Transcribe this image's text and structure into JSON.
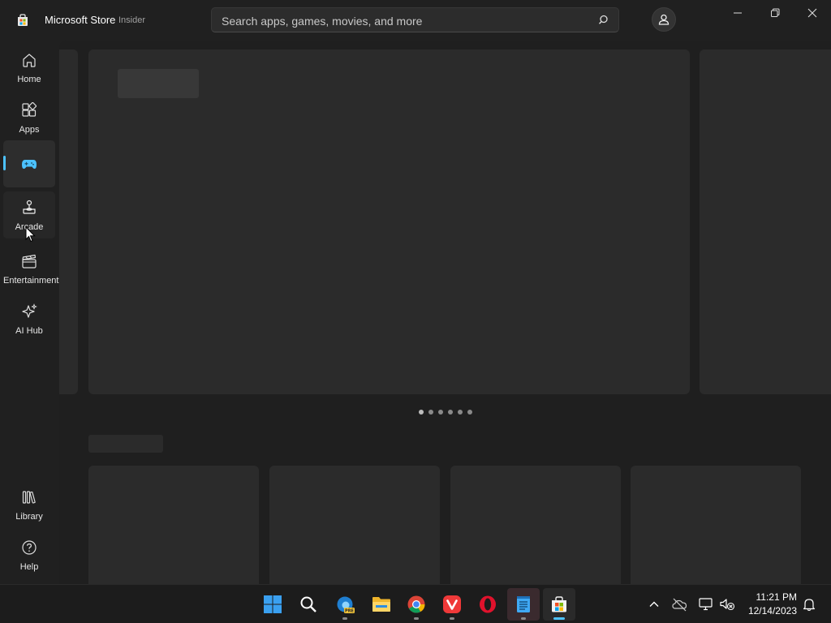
{
  "window": {
    "title": "Microsoft Store",
    "badge": "Insider",
    "search_placeholder": "Search apps, games, movies, and more",
    "controls": [
      "minimize-icon",
      "restore-icon",
      "close-icon"
    ]
  },
  "sidebar": {
    "items": [
      {
        "label": "Home",
        "icon": "home-icon"
      },
      {
        "label": "Apps",
        "icon": "apps-icon"
      },
      {
        "label": "",
        "icon": "gamepad-icon",
        "active": true
      },
      {
        "label": "Arcade",
        "icon": "joystick-icon"
      },
      {
        "label": "Entertainment",
        "icon": "clapperboard-icon"
      },
      {
        "label": "AI Hub",
        "icon": "sparkle-icon"
      }
    ],
    "bottom_items": [
      {
        "label": "Library",
        "icon": "library-icon"
      },
      {
        "label": "Help",
        "icon": "help-icon"
      }
    ]
  },
  "hero": {
    "carousel_pages": 6,
    "current_page": 1
  },
  "taskbar": {
    "apps": [
      "start-icon",
      "search-icon",
      "edge-canary-icon",
      "file-explorer-icon",
      "chrome-icon",
      "vivaldi-icon",
      "opera-icon",
      "notepad-icon",
      "microsoft-store-icon"
    ],
    "tray_icons": [
      "chevron-up-icon",
      "onedrive-offline-icon",
      "network-icon",
      "volume-muted-icon",
      "notification-bell-icon"
    ],
    "time": "11:21 PM",
    "date": "12/14/2023"
  },
  "colors": {
    "accent": "#4cc2ff",
    "background": "#202020"
  }
}
